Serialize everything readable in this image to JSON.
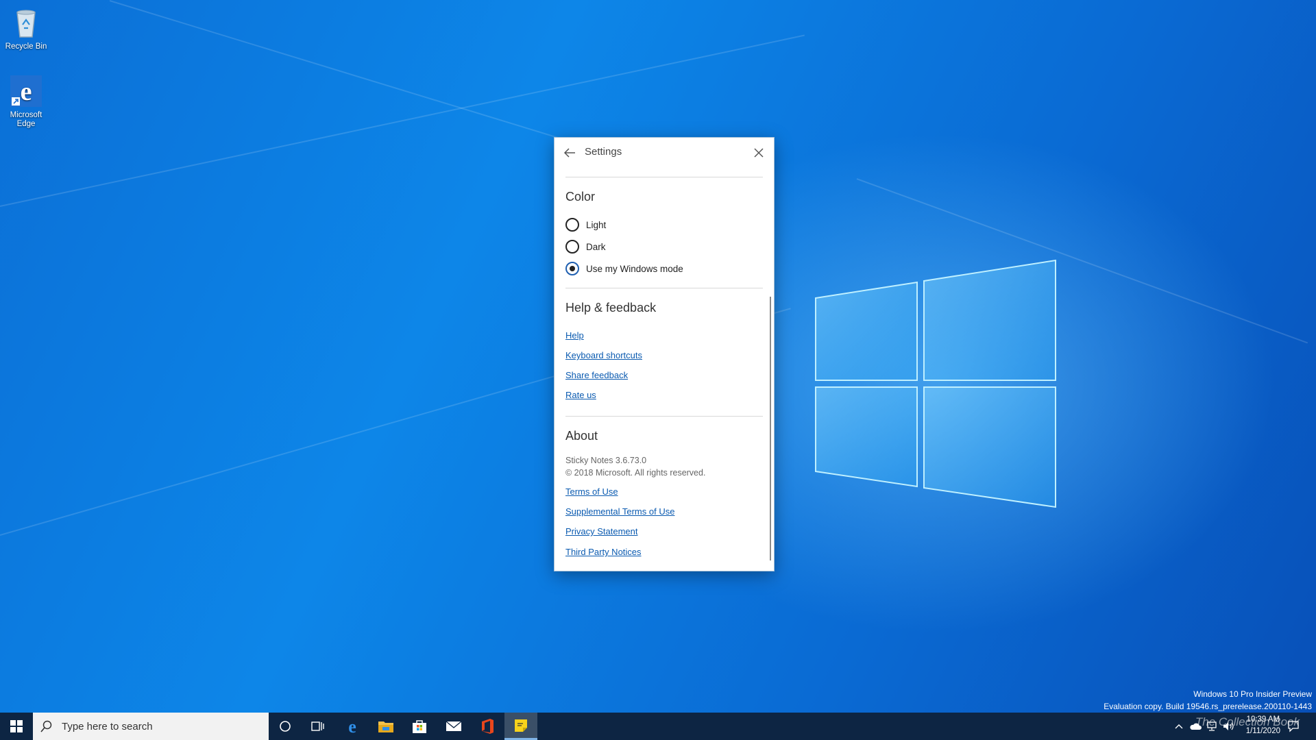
{
  "desktop": {
    "icons": [
      {
        "label": "Recycle Bin",
        "icon": "recycle-bin-icon"
      },
      {
        "label": "Microsoft Edge",
        "icon": "edge-icon"
      }
    ],
    "watermark_line1": "Windows 10 Pro Insider Preview",
    "watermark_line2": "Evaluation copy. Build 19546.rs_prerelease.200110-1443"
  },
  "settings": {
    "title": "Settings",
    "color_section": {
      "heading": "Color",
      "options": [
        {
          "label": "Light",
          "checked": false
        },
        {
          "label": "Dark",
          "checked": false
        },
        {
          "label": "Use my Windows mode",
          "checked": true
        }
      ]
    },
    "help_section": {
      "heading": "Help & feedback",
      "links": [
        "Help",
        "Keyboard shortcuts",
        "Share feedback",
        "Rate us"
      ]
    },
    "about_section": {
      "heading": "About",
      "version": "Sticky Notes 3.6.73.0",
      "copyright": "© 2018 Microsoft. All rights reserved.",
      "links": [
        "Terms of Use",
        "Supplemental Terms of Use",
        "Privacy Statement",
        "Third Party Notices"
      ]
    }
  },
  "taskbar": {
    "search_placeholder": "Type here to search",
    "pinned": [
      {
        "name": "cortana-icon"
      },
      {
        "name": "task-view-icon"
      },
      {
        "name": "edge-icon"
      },
      {
        "name": "file-explorer-icon"
      },
      {
        "name": "store-icon"
      },
      {
        "name": "mail-icon"
      },
      {
        "name": "office-icon"
      },
      {
        "name": "sticky-notes-icon",
        "active": true
      }
    ],
    "clock_time": "10:39 AM",
    "clock_date": "1/11/2020",
    "overlay_text": "The Collection Book"
  },
  "colors": {
    "taskbar": "#0d2543",
    "link": "#0a5ab0",
    "desktop": "#0a78d8"
  }
}
